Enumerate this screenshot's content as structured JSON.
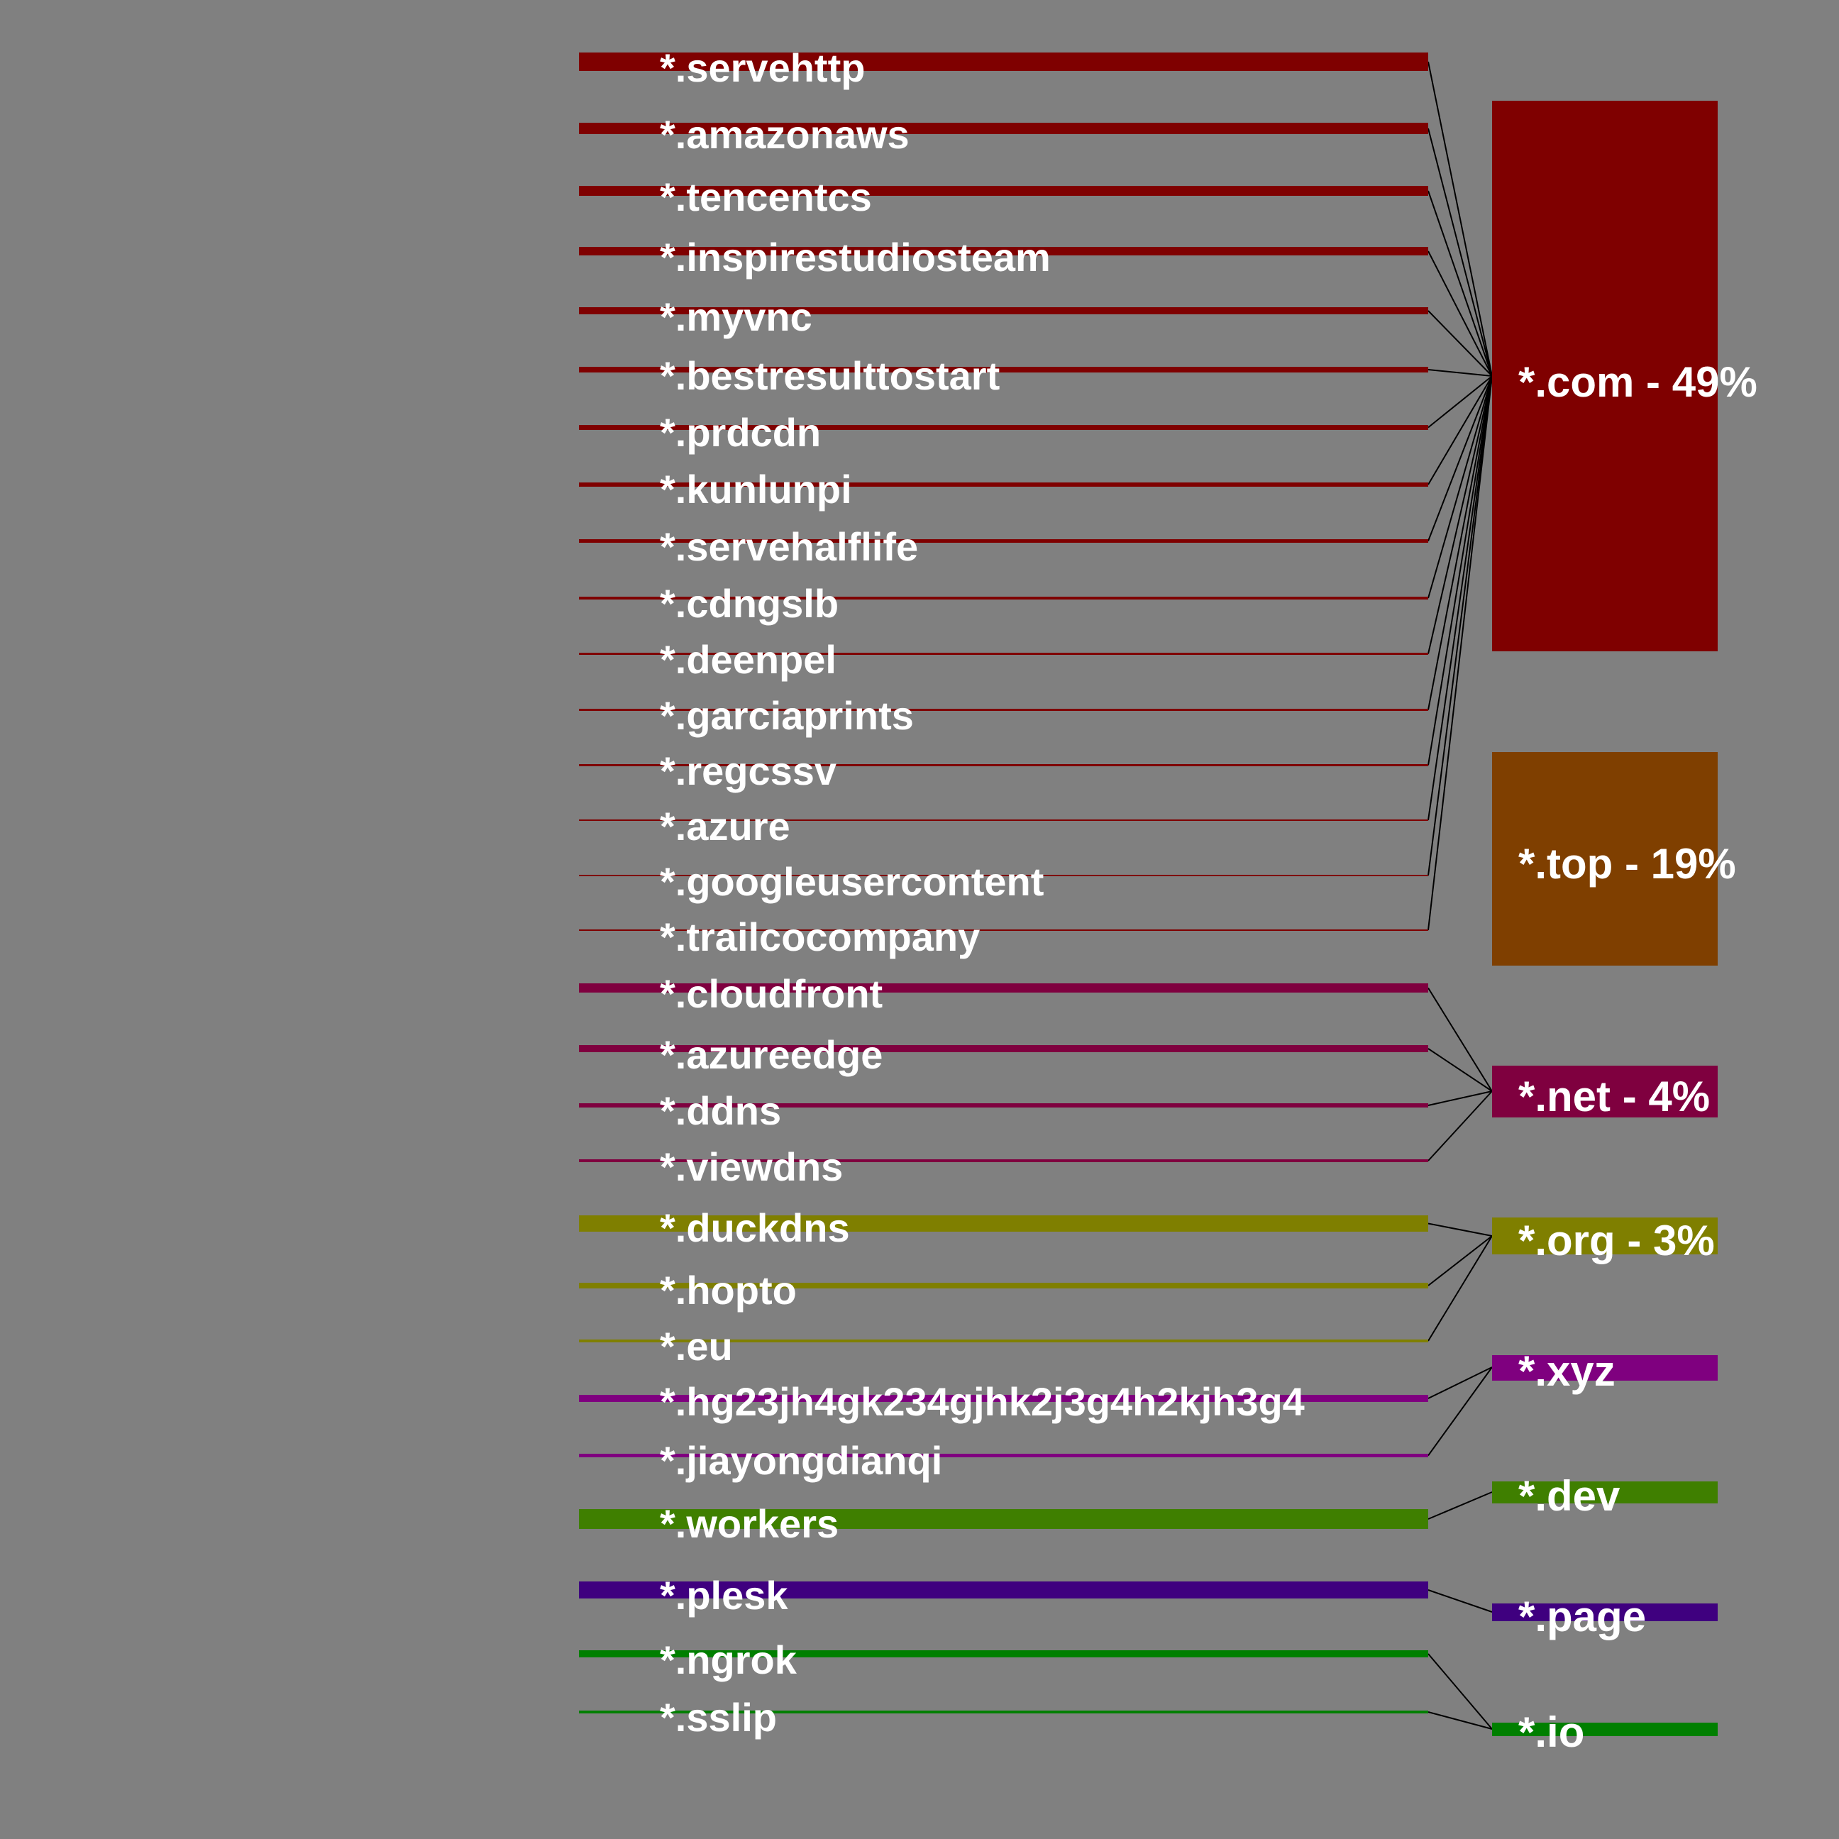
{
  "tlds": [
    {
      "label": "*.com - 49%",
      "color": "#7f0000"
    },
    {
      "label": "*.top - 19%",
      "color": "#7f3f00"
    },
    {
      "label": "*.net - 4%",
      "color": "#7f003f"
    },
    {
      "label": "*.org - 3%",
      "color": "#7f7f00"
    },
    {
      "label": "*.xyz",
      "color": "#7f007f"
    },
    {
      "label": "*.dev",
      "color": "#3f7f00"
    },
    {
      "label": "*.page",
      "color": "#3f007f"
    },
    {
      "label": "*.io",
      "color": "#007f00"
    }
  ],
  "subdomains": [
    {
      "label": "*.servehttp",
      "tld": 0
    },
    {
      "label": "*.amazonaws",
      "tld": 0
    },
    {
      "label": "*.tencentcs",
      "tld": 0
    },
    {
      "label": "*.inspirestudiosteam",
      "tld": 0
    },
    {
      "label": "*.myvnc",
      "tld": 0
    },
    {
      "label": "*.bestresulttostart",
      "tld": 0
    },
    {
      "label": "*.prdcdn",
      "tld": 0
    },
    {
      "label": "*.kunlunpi",
      "tld": 0
    },
    {
      "label": "*.servehalflife",
      "tld": 0
    },
    {
      "label": "*.cdngslb",
      "tld": 0
    },
    {
      "label": "*.deenpel",
      "tld": 0
    },
    {
      "label": "*.garciaprints",
      "tld": 0
    },
    {
      "label": "*.regcssv",
      "tld": 0
    },
    {
      "label": "*.azure",
      "tld": 0
    },
    {
      "label": "*.googleusercontent",
      "tld": 0
    },
    {
      "label": "*.trailcocompany",
      "tld": 0
    },
    {
      "label": "*.cloudfront",
      "tld": 2
    },
    {
      "label": "*.azureedge",
      "tld": 2
    },
    {
      "label": "*.ddns",
      "tld": 2
    },
    {
      "label": "*.viewdns",
      "tld": 2
    },
    {
      "label": "*.duckdns",
      "tld": 3
    },
    {
      "label": "*.hopto",
      "tld": 3
    },
    {
      "label": "*.eu",
      "tld": 3
    },
    {
      "label": "*.hg23jh4gk234gjhk2j3g4h2kjh3g4",
      "tld": 4
    },
    {
      "label": "*.jiayongdianqi",
      "tld": 4
    },
    {
      "label": "*.workers",
      "tld": 5
    },
    {
      "label": "*.plesk",
      "tld": 6
    },
    {
      "label": "*.ngrok",
      "tld": 7
    },
    {
      "label": "*.sslip",
      "tld": 7
    }
  ]
}
